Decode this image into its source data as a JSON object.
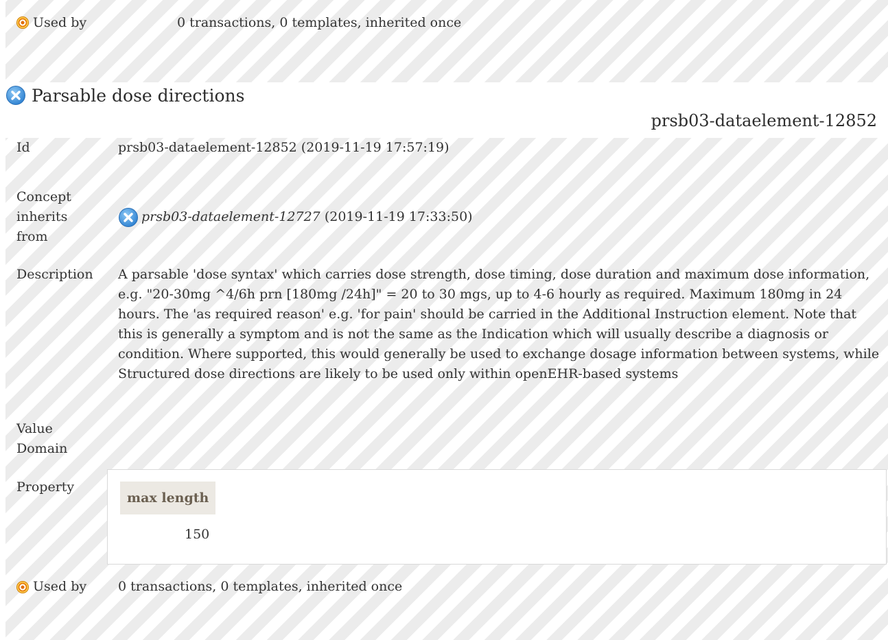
{
  "top": {
    "used_by_label": "Used by",
    "used_by_value": "0 transactions, 0 templates, inherited once"
  },
  "element": {
    "title": "Parsable dose directions",
    "id_header": "prsb03-dataelement-12852",
    "rows": {
      "id_label": "Id",
      "id_value": "prsb03-dataelement-12852 (2019-11-19 17:57:19)",
      "concept_label": "Concept inherits from",
      "concept_ref": "prsb03-dataelement-12727",
      "concept_date": "(2019-11-19 17:33:50)",
      "description_label": "Description",
      "description_value": "A parsable 'dose syntax' which carries dose strength, dose timing, dose duration and maximum dose information, e.g. \"20-30mg ^4/6h prn [180mg /24h]\" = 20 to 30 mgs, up to 4-6 hourly as required. Maximum 180mg in 24 hours. The 'as required reason' e.g. 'for pain' should be carried in the Additional Instruction element. Note that this is generally a symptom and is not the same as the Indication which will usually describe a diagnosis or condition. Where supported, this would generally be used to exchange dosage information between systems, while Structured dose directions are likely to be used only within openEHR-based systems",
      "value_domain_label": "Value Domain",
      "property_label": "Property",
      "property_header": "max length",
      "property_value": "150",
      "used_by_label": "Used by",
      "used_by_value": "0 transactions, 0 templates, inherited once"
    }
  },
  "icons": {
    "used_by": "target-icon",
    "status": "cancelled-x-icon"
  },
  "colors": {
    "status_icon": "#3b8fd6",
    "used_by_icon": "#f0a020"
  }
}
